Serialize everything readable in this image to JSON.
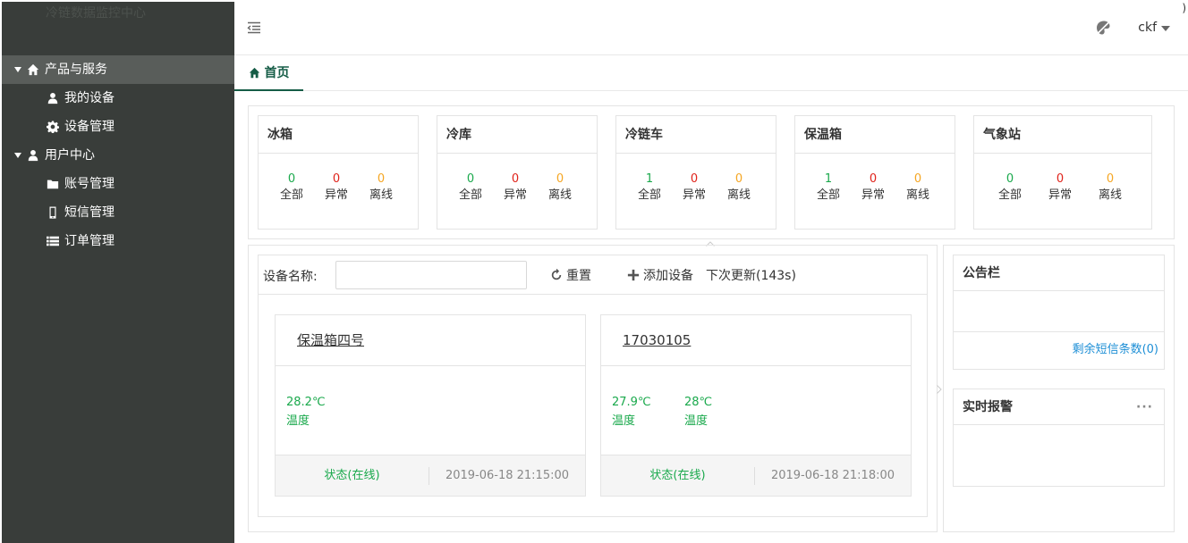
{
  "brand": "冷链数据监控中心",
  "corner_mark": ")",
  "sidebar": {
    "groups": [
      {
        "label": "产品与服务",
        "items": [
          {
            "label": "我的设备"
          },
          {
            "label": "设备管理"
          }
        ]
      },
      {
        "label": "用户中心",
        "items": [
          {
            "label": "账号管理"
          },
          {
            "label": "短信管理"
          },
          {
            "label": "订单管理"
          }
        ]
      }
    ]
  },
  "header": {
    "user_name": "ckf"
  },
  "tabs": [
    {
      "label": "首页"
    }
  ],
  "categories": [
    {
      "title": "冰箱",
      "stats": [
        {
          "value": "0",
          "label": "全部"
        },
        {
          "value": "0",
          "label": "异常"
        },
        {
          "value": "0",
          "label": "离线"
        }
      ]
    },
    {
      "title": "冷库",
      "stats": [
        {
          "value": "0",
          "label": "全部"
        },
        {
          "value": "0",
          "label": "异常"
        },
        {
          "value": "0",
          "label": "离线"
        }
      ]
    },
    {
      "title": "冷链车",
      "stats": [
        {
          "value": "1",
          "label": "全部"
        },
        {
          "value": "0",
          "label": "异常"
        },
        {
          "value": "0",
          "label": "离线"
        }
      ]
    },
    {
      "title": "保温箱",
      "stats": [
        {
          "value": "1",
          "label": "全部"
        },
        {
          "value": "0",
          "label": "异常"
        },
        {
          "value": "0",
          "label": "离线"
        }
      ]
    },
    {
      "title": "气象站",
      "stats": [
        {
          "value": "0",
          "label": "全部"
        },
        {
          "value": "0",
          "label": "异常"
        },
        {
          "value": "0",
          "label": "离线"
        }
      ]
    }
  ],
  "search": {
    "label": "设备名称:",
    "value": "",
    "reset_label": "重置",
    "add_label": "添加设备",
    "next_update": "下次更新(143s)"
  },
  "devices": [
    {
      "name": "保温箱四号",
      "readings": [
        {
          "value": "28.2℃",
          "label": "温度"
        }
      ],
      "status": "状态(在线)",
      "time": "2019-06-18 21:15:00"
    },
    {
      "name": "17030105",
      "readings": [
        {
          "value": "27.9℃",
          "label": "温度"
        },
        {
          "value": "28℃",
          "label": "温度"
        }
      ],
      "status": "状态(在线)",
      "time": "2019-06-18 21:18:00"
    }
  ],
  "notice": {
    "title": "公告栏",
    "sms_link": "剩余短信条数(0)"
  },
  "alarm": {
    "title": "实时报警",
    "more": "···"
  },
  "colors": {
    "sidebar_bg": "#393d3a",
    "accent": "#155c46",
    "green": "#1aa94c",
    "red": "#e0231b",
    "orange": "#f5a623",
    "link": "#1e8fd6"
  }
}
